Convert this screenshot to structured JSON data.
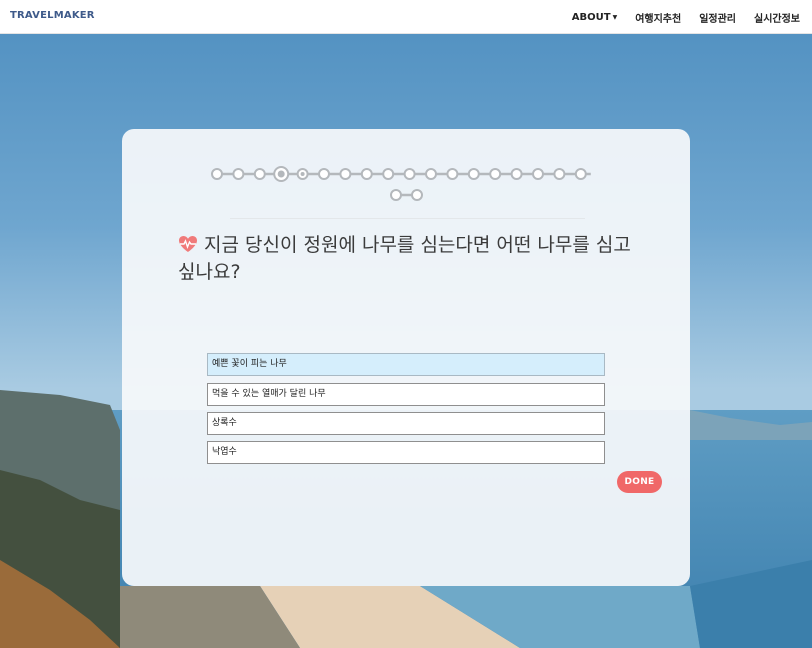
{
  "navbar": {
    "brand": "TRAVELMAKER",
    "menu": [
      {
        "label": "ABOUT",
        "has_dropdown": true
      },
      {
        "label": "여행지추천",
        "has_dropdown": false
      },
      {
        "label": "일정관리",
        "has_dropdown": false
      },
      {
        "label": "실시간정보",
        "has_dropdown": false
      }
    ]
  },
  "survey": {
    "progress": {
      "total_steps": 20,
      "current_step": 4
    },
    "question": "지금 당신이 정원에 나무를 심는다면 어떤 나무를 심고 싶나요?",
    "question_icon": "heart-pulse-icon",
    "options": [
      {
        "label": "예쁜 꽃이 피는 나무",
        "selected": true
      },
      {
        "label": "먹을 수 있는 열매가 달린 나무",
        "selected": false
      },
      {
        "label": "상록수",
        "selected": false
      },
      {
        "label": "낙엽수",
        "selected": false
      }
    ],
    "done_label": "DONE"
  },
  "colors": {
    "accent": "#f06868",
    "brand": "#3e5a8a",
    "selected_option": "#d5eefc",
    "progress": "#b4b8bc"
  }
}
